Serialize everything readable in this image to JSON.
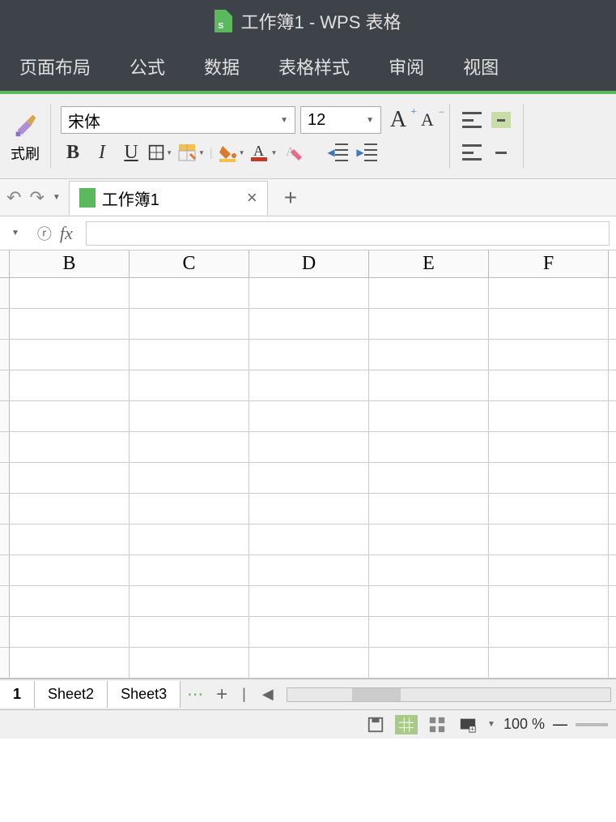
{
  "titlebar": {
    "title": "工作簿1 - WPS 表格"
  },
  "menu": {
    "page_layout": "页面布局",
    "formula": "公式",
    "data": "数据",
    "table_style": "表格样式",
    "review": "审阅",
    "view": "视图"
  },
  "ribbon": {
    "format_painter": "式刷",
    "font_name": "宋体",
    "font_size": "12",
    "bold": "B",
    "italic": "I",
    "underline": "U",
    "increase_font": "A",
    "decrease_font": "A"
  },
  "doc_tabs": {
    "workbook": "工作簿1"
  },
  "formula_bar": {
    "fx": "fx"
  },
  "columns": [
    "B",
    "C",
    "D",
    "E",
    "F"
  ],
  "sheets": {
    "sheet1_suffix": "1",
    "sheet2": "Sheet2",
    "sheet3": "Sheet3"
  },
  "statusbar": {
    "zoom": "100 %"
  }
}
